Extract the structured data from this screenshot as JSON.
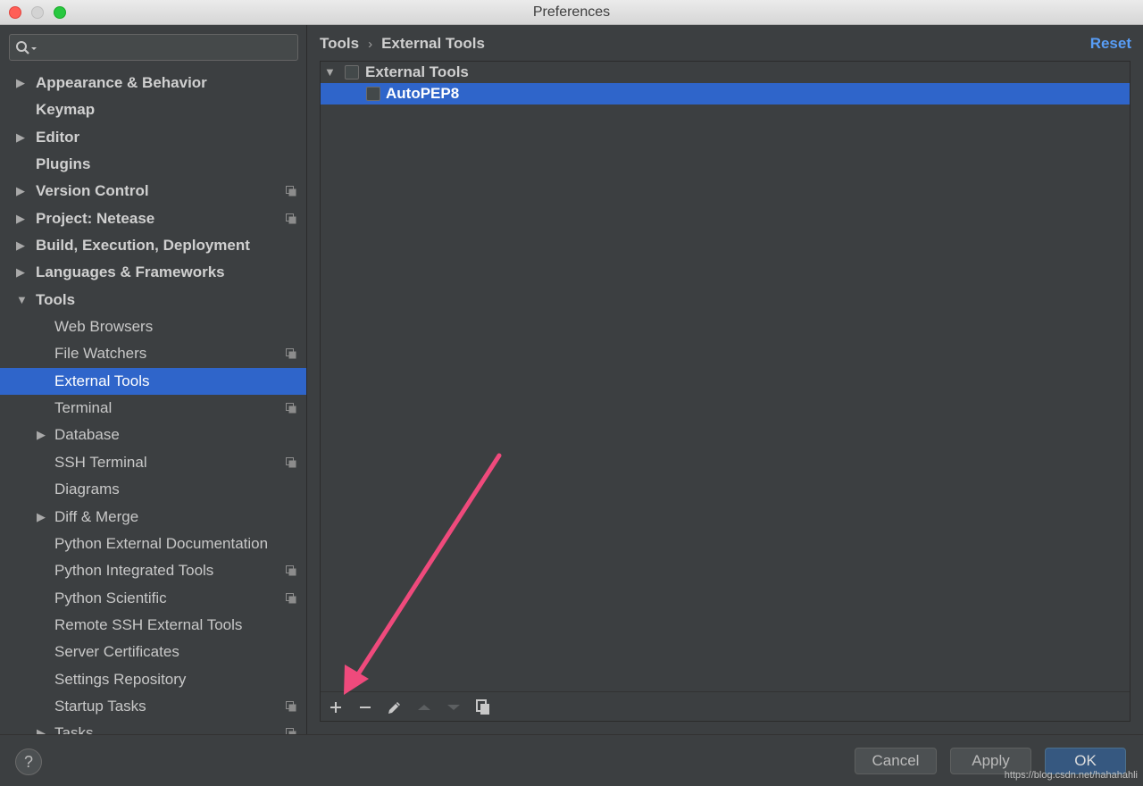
{
  "window": {
    "title": "Preferences"
  },
  "sidebar": {
    "search": {
      "placeholder": ""
    },
    "items": [
      {
        "label": "Appearance & Behavior",
        "arrow": "▶",
        "bold": true,
        "indent": 0,
        "project": false
      },
      {
        "label": "Keymap",
        "arrow": "",
        "bold": true,
        "indent": 0,
        "project": false
      },
      {
        "label": "Editor",
        "arrow": "▶",
        "bold": true,
        "indent": 0,
        "project": false
      },
      {
        "label": "Plugins",
        "arrow": "",
        "bold": true,
        "indent": 0,
        "project": false
      },
      {
        "label": "Version Control",
        "arrow": "▶",
        "bold": true,
        "indent": 0,
        "project": true
      },
      {
        "label": "Project: Netease",
        "arrow": "▶",
        "bold": true,
        "indent": 0,
        "project": true
      },
      {
        "label": "Build, Execution, Deployment",
        "arrow": "▶",
        "bold": true,
        "indent": 0,
        "project": false
      },
      {
        "label": "Languages & Frameworks",
        "arrow": "▶",
        "bold": true,
        "indent": 0,
        "project": false
      },
      {
        "label": "Tools",
        "arrow": "▼",
        "bold": true,
        "indent": 0,
        "project": false
      },
      {
        "label": "Web Browsers",
        "arrow": "",
        "bold": false,
        "indent": 1,
        "project": false
      },
      {
        "label": "File Watchers",
        "arrow": "",
        "bold": false,
        "indent": 1,
        "project": true
      },
      {
        "label": "External Tools",
        "arrow": "",
        "bold": false,
        "indent": 1,
        "project": false,
        "selected": true
      },
      {
        "label": "Terminal",
        "arrow": "",
        "bold": false,
        "indent": 1,
        "project": true
      },
      {
        "label": "Database",
        "arrow": "▶",
        "bold": false,
        "indent": 1,
        "project": false
      },
      {
        "label": "SSH Terminal",
        "arrow": "",
        "bold": false,
        "indent": 1,
        "project": true
      },
      {
        "label": "Diagrams",
        "arrow": "",
        "bold": false,
        "indent": 1,
        "project": false
      },
      {
        "label": "Diff & Merge",
        "arrow": "▶",
        "bold": false,
        "indent": 1,
        "project": false
      },
      {
        "label": "Python External Documentation",
        "arrow": "",
        "bold": false,
        "indent": 1,
        "project": false
      },
      {
        "label": "Python Integrated Tools",
        "arrow": "",
        "bold": false,
        "indent": 1,
        "project": true
      },
      {
        "label": "Python Scientific",
        "arrow": "",
        "bold": false,
        "indent": 1,
        "project": true
      },
      {
        "label": "Remote SSH External Tools",
        "arrow": "",
        "bold": false,
        "indent": 1,
        "project": false
      },
      {
        "label": "Server Certificates",
        "arrow": "",
        "bold": false,
        "indent": 1,
        "project": false
      },
      {
        "label": "Settings Repository",
        "arrow": "",
        "bold": false,
        "indent": 1,
        "project": false
      },
      {
        "label": "Startup Tasks",
        "arrow": "",
        "bold": false,
        "indent": 1,
        "project": true
      },
      {
        "label": "Tasks",
        "arrow": "▶",
        "bold": false,
        "indent": 1,
        "project": true
      }
    ]
  },
  "content": {
    "breadcrumb": {
      "parent": "Tools",
      "separator": "›",
      "current": "External Tools"
    },
    "reset_label": "Reset",
    "tree": {
      "group": {
        "label": "External Tools",
        "arrow": "▼"
      },
      "tool": {
        "label": "AutoPEP8"
      }
    },
    "toolbar": {
      "add_icon": "plus-icon",
      "remove_icon": "minus-icon",
      "edit_icon": "pencil-icon",
      "up_icon": "arrow-up-icon",
      "down_icon": "arrow-down-icon",
      "copy_icon": "copy-icon"
    }
  },
  "footer": {
    "help_label": "?",
    "cancel_label": "Cancel",
    "apply_label": "Apply",
    "ok_label": "OK",
    "watermark": "https://blog.csdn.net/hahahahli"
  },
  "colors": {
    "selection": "#2f65ca",
    "link": "#589df6",
    "annotation_arrow": "#ef4a7c"
  }
}
